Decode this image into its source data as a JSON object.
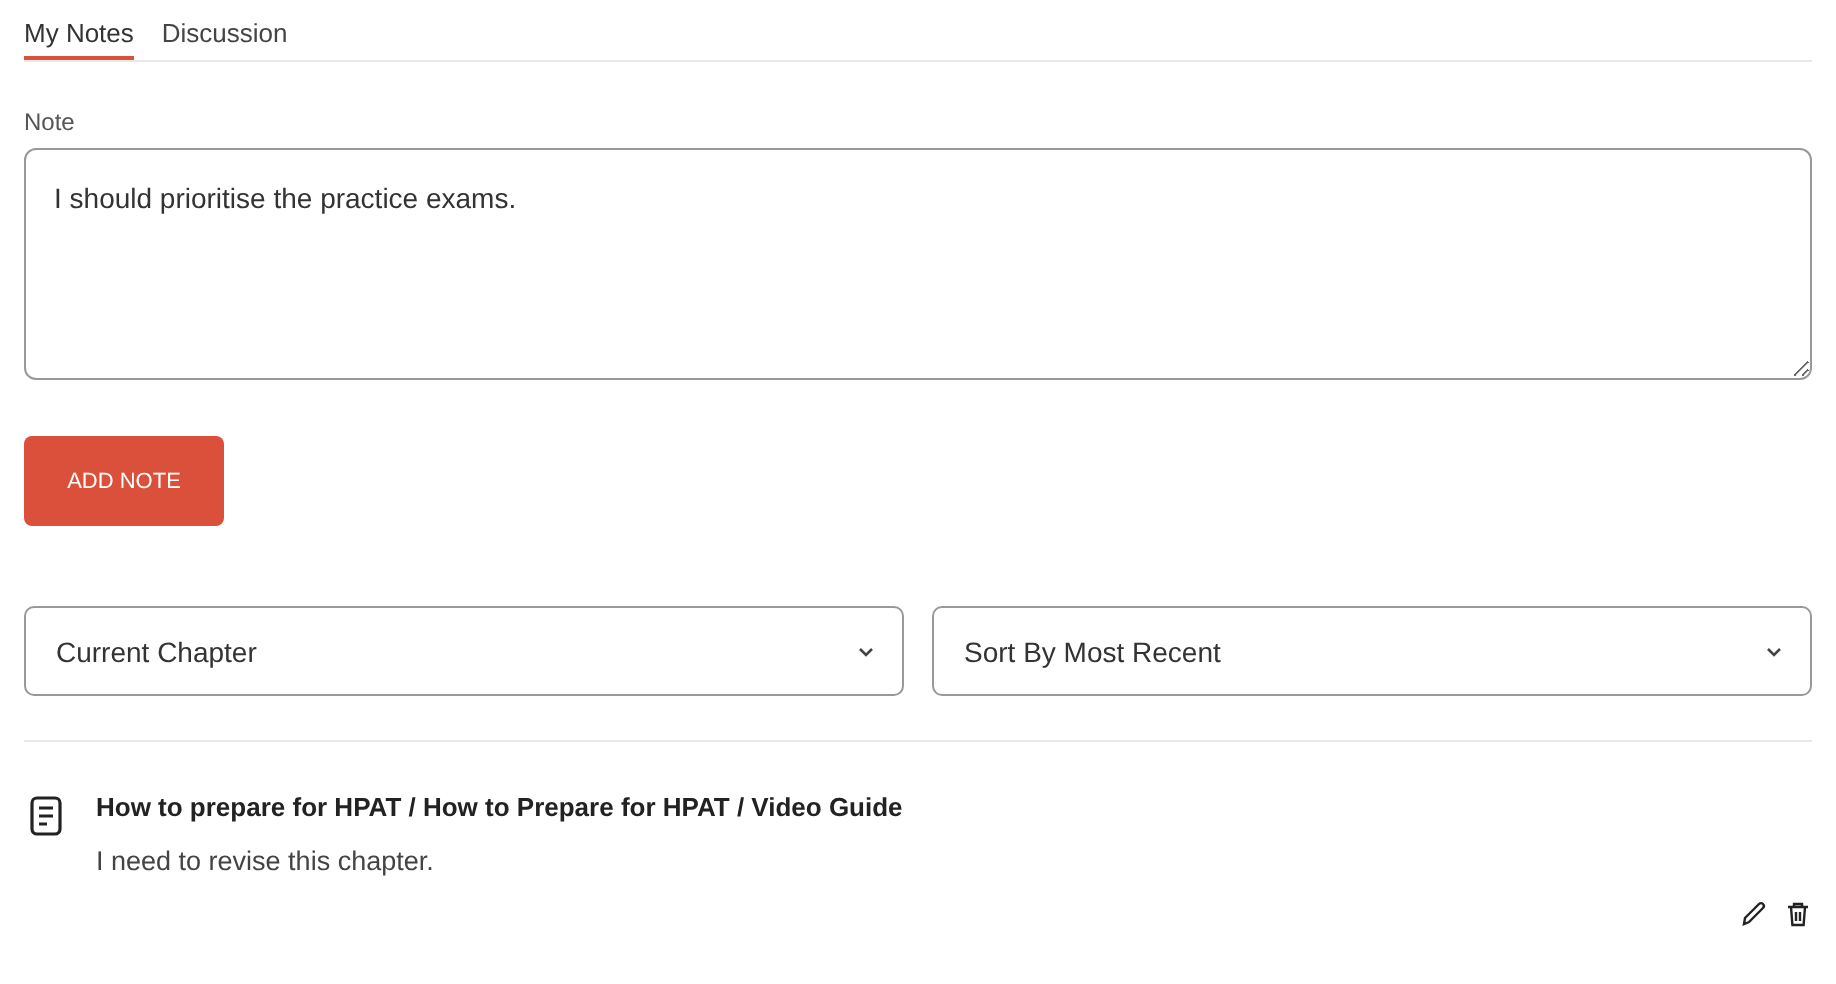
{
  "tabs": [
    {
      "label": "My Notes",
      "selected": true
    },
    {
      "label": "Discussion",
      "selected": false
    }
  ],
  "note_form": {
    "label": "Note",
    "value": "I should prioritise the practice exams.",
    "button": "ADD NOTE"
  },
  "filters": [
    {
      "value": "Current Chapter"
    },
    {
      "value": "Sort By Most Recent"
    }
  ],
  "notes": [
    {
      "title": "How to prepare for HPAT / How to Prepare for HPAT / Video Guide",
      "body": "I need to revise this chapter."
    }
  ]
}
